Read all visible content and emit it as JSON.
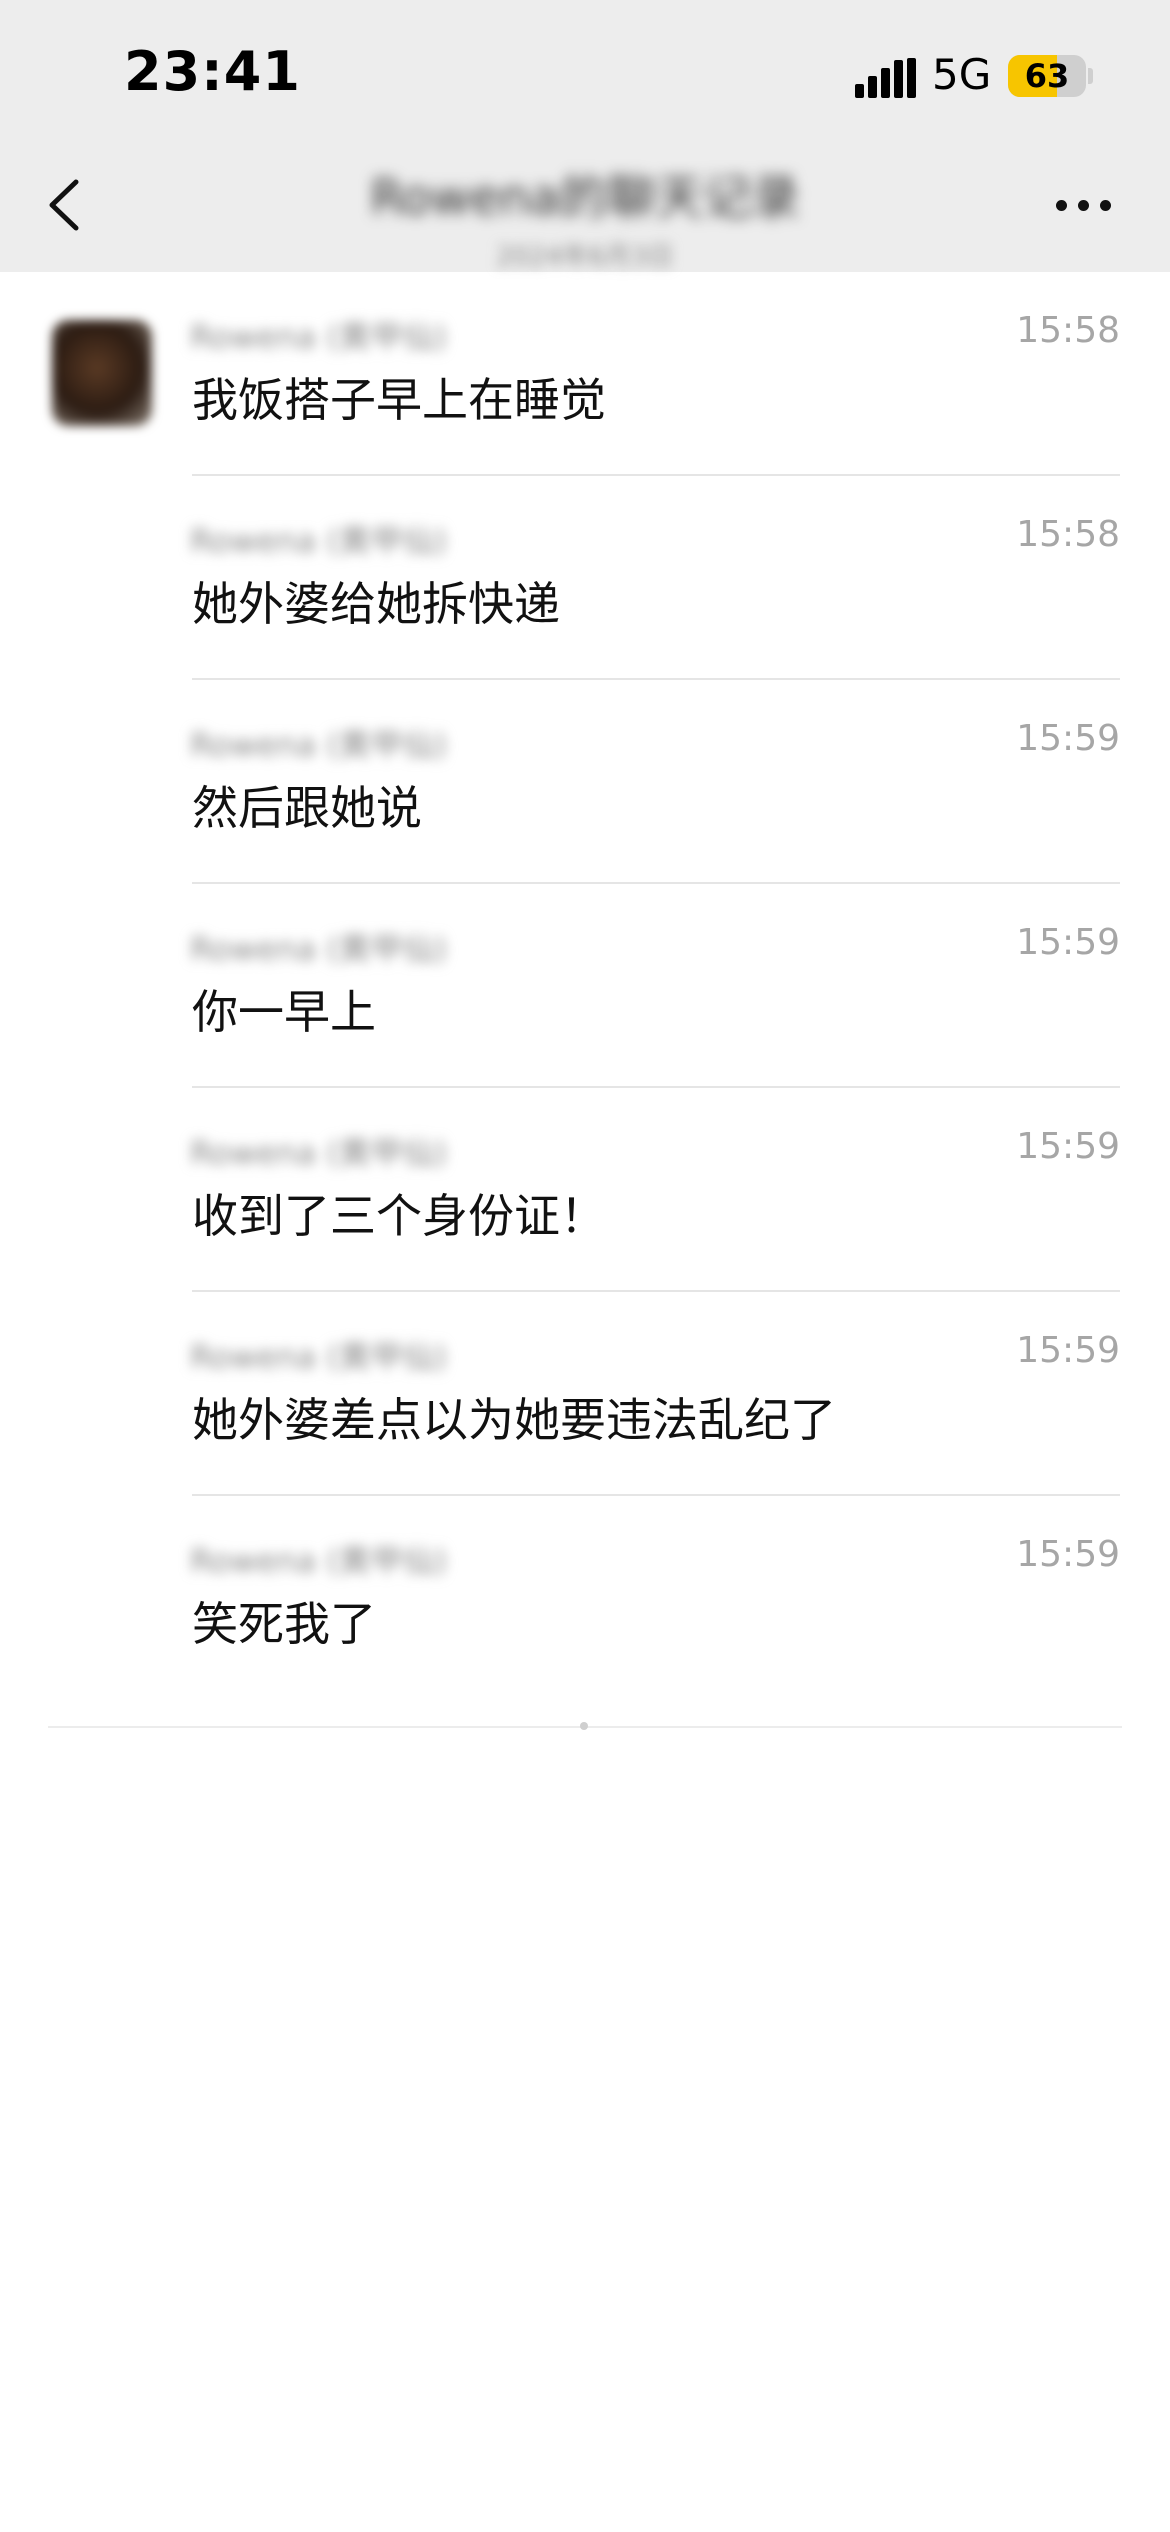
{
  "status_bar": {
    "time": "23:41",
    "network": "5G",
    "battery_percent": 63,
    "battery_label": "63"
  },
  "header": {
    "title": "Rowena的聊天记录",
    "subtitle": "2024年6月3日",
    "back_icon": "chevron-left-icon",
    "more_icon": "more-dots-icon"
  },
  "messages": [
    {
      "sender": "Rowena (黄甲仙)",
      "time": "15:58",
      "text": "我饭搭子早上在睡觉",
      "show_avatar": true
    },
    {
      "sender": "Rowena (黄甲仙)",
      "time": "15:58",
      "text": "她外婆给她拆快递",
      "show_avatar": false
    },
    {
      "sender": "Rowena (黄甲仙)",
      "time": "15:59",
      "text": "然后跟她说",
      "show_avatar": false
    },
    {
      "sender": "Rowena (黄甲仙)",
      "time": "15:59",
      "text": "你一早上",
      "show_avatar": false
    },
    {
      "sender": "Rowena (黄甲仙)",
      "time": "15:59",
      "text": "收到了三个身份证！",
      "show_avatar": false
    },
    {
      "sender": "Rowena (黄甲仙)",
      "time": "15:59",
      "text": "她外婆差点以为她要违法乱纪了",
      "show_avatar": false
    },
    {
      "sender": "Rowena (黄甲仙)",
      "time": "15:59",
      "text": "笑死我了",
      "show_avatar": false
    }
  ],
  "colors": {
    "header_bg": "#ededed",
    "battery_fill": "#f7c500",
    "timestamp": "#a6a6a6"
  }
}
